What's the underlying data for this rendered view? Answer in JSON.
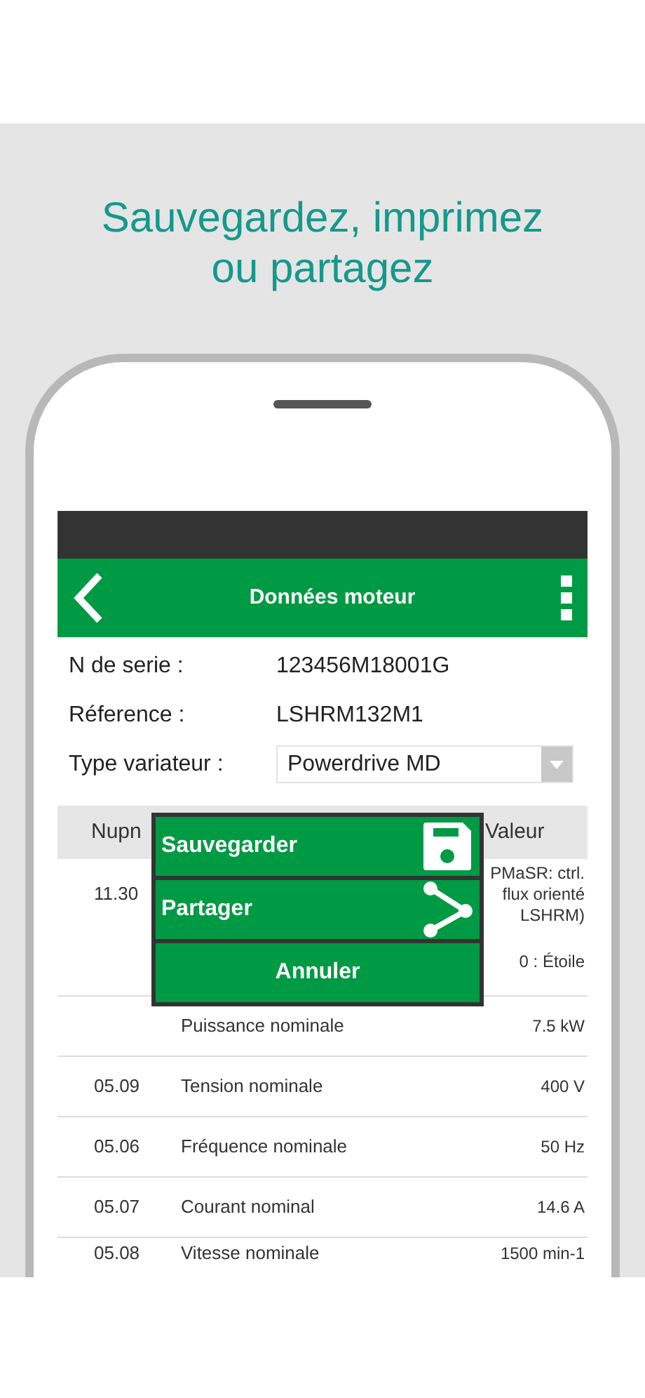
{
  "headline": "Sauvegardez, imprimez ou partagez",
  "app_bar": {
    "title": "Données moteur"
  },
  "fields": [
    {
      "label": "N de serie :",
      "value": "123456M18001G",
      "kind": "text"
    },
    {
      "label": "Réference :",
      "value": "LSHRM132M1",
      "kind": "text"
    },
    {
      "label": "Type variateur :",
      "value": "Powerdrive MD",
      "kind": "select"
    }
  ],
  "table": {
    "columns": [
      "Nupn",
      "Valeur"
    ],
    "rows": [
      {
        "nupn": "11.30",
        "name": "",
        "value": "PMaSR: ctrl. flux orienté LSHRM)"
      },
      {
        "nupn": "",
        "name": "",
        "value": "0 : Étoile"
      },
      {
        "nupn": "",
        "name": "Puissance nominale",
        "value": "7.5 kW"
      },
      {
        "nupn": "05.09",
        "name": "Tension nominale",
        "value": "400 V"
      },
      {
        "nupn": "05.06",
        "name": "Fréquence nominale",
        "value": "50 Hz"
      },
      {
        "nupn": "05.07",
        "name": "Courant nominal",
        "value": "14.6 A"
      },
      {
        "nupn": "05.08",
        "name": "Vitesse nominale",
        "value": "1500 min-1"
      }
    ]
  },
  "menu": [
    {
      "label": "Sauvegarder",
      "kind": "save"
    },
    {
      "label": "Partager",
      "kind": "share"
    },
    {
      "label": "Annuler",
      "kind": "cancel"
    }
  ]
}
